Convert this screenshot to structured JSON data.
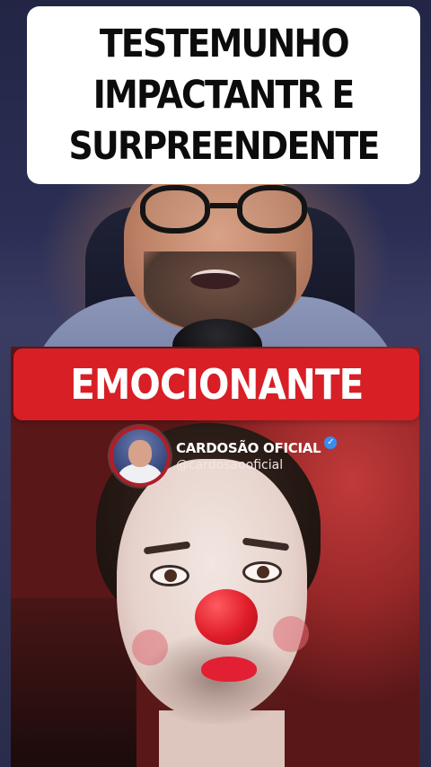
{
  "title_card": {
    "lines": [
      "TESTEMUNHO",
      "IMPACTANTR E",
      "SURPREENDENTE"
    ]
  },
  "banner": {
    "label": "EMOCIONANTE",
    "color": "#d81f26"
  },
  "profile": {
    "name": "CARDOSÃO OFICIAL",
    "handle": "@cardosaooficial",
    "verified_icon": "verified-badge-icon",
    "verified_glyph": "✓"
  },
  "colors": {
    "title_bg": "#ffffff",
    "title_text": "#0c0c0c",
    "verified": "#3a8df0"
  }
}
